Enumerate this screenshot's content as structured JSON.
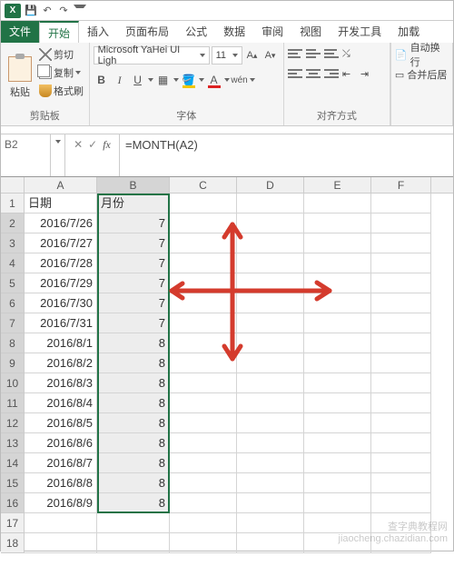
{
  "titlebar": {
    "app_label": "X"
  },
  "tabs": {
    "file": "文件",
    "home": "开始",
    "insert": "插入",
    "layout": "页面布局",
    "formulas": "公式",
    "data": "数据",
    "review": "审阅",
    "view": "视图",
    "developer": "开发工具",
    "addins": "加载"
  },
  "ribbon": {
    "clipboard": {
      "paste": "粘贴",
      "cut": "剪切",
      "copy": "复制",
      "brush": "格式刷",
      "group_label": "剪贴板"
    },
    "font": {
      "name": "Microsoft YaHei UI Ligh",
      "size": "11",
      "group_label": "字体",
      "B": "B",
      "I": "I",
      "U": "U",
      "wen": "wén"
    },
    "alignment": {
      "wrap": "自动换行",
      "merge": "合并后居",
      "group_label": "对齐方式"
    }
  },
  "formula_bar": {
    "cell_ref": "B2",
    "formula": "=MONTH(A2)"
  },
  "grid": {
    "columns": [
      "A",
      "B",
      "C",
      "D",
      "E",
      "F"
    ],
    "headers": {
      "A": "日期",
      "B": "月份"
    },
    "rows": [
      {
        "n": 1,
        "A": "日期",
        "B": "月份",
        "header": true
      },
      {
        "n": 2,
        "A": "2016/7/26",
        "B": "7"
      },
      {
        "n": 3,
        "A": "2016/7/27",
        "B": "7"
      },
      {
        "n": 4,
        "A": "2016/7/28",
        "B": "7"
      },
      {
        "n": 5,
        "A": "2016/7/29",
        "B": "7"
      },
      {
        "n": 6,
        "A": "2016/7/30",
        "B": "7"
      },
      {
        "n": 7,
        "A": "2016/7/31",
        "B": "7"
      },
      {
        "n": 8,
        "A": "2016/8/1",
        "B": "8"
      },
      {
        "n": 9,
        "A": "2016/8/2",
        "B": "8"
      },
      {
        "n": 10,
        "A": "2016/8/3",
        "B": "8"
      },
      {
        "n": 11,
        "A": "2016/8/4",
        "B": "8"
      },
      {
        "n": 12,
        "A": "2016/8/5",
        "B": "8"
      },
      {
        "n": 13,
        "A": "2016/8/6",
        "B": "8"
      },
      {
        "n": 14,
        "A": "2016/8/7",
        "B": "8"
      },
      {
        "n": 15,
        "A": "2016/8/8",
        "B": "8"
      },
      {
        "n": 16,
        "A": "2016/8/9",
        "B": "8"
      },
      {
        "n": 17,
        "A": "",
        "B": ""
      },
      {
        "n": 18,
        "A": "",
        "B": ""
      }
    ]
  },
  "watermark": {
    "line1": "查字典教程网",
    "line2": "jiaocheng.chazidian.com"
  },
  "colors": {
    "accent": "#217346",
    "annotation": "#d43b2d"
  }
}
